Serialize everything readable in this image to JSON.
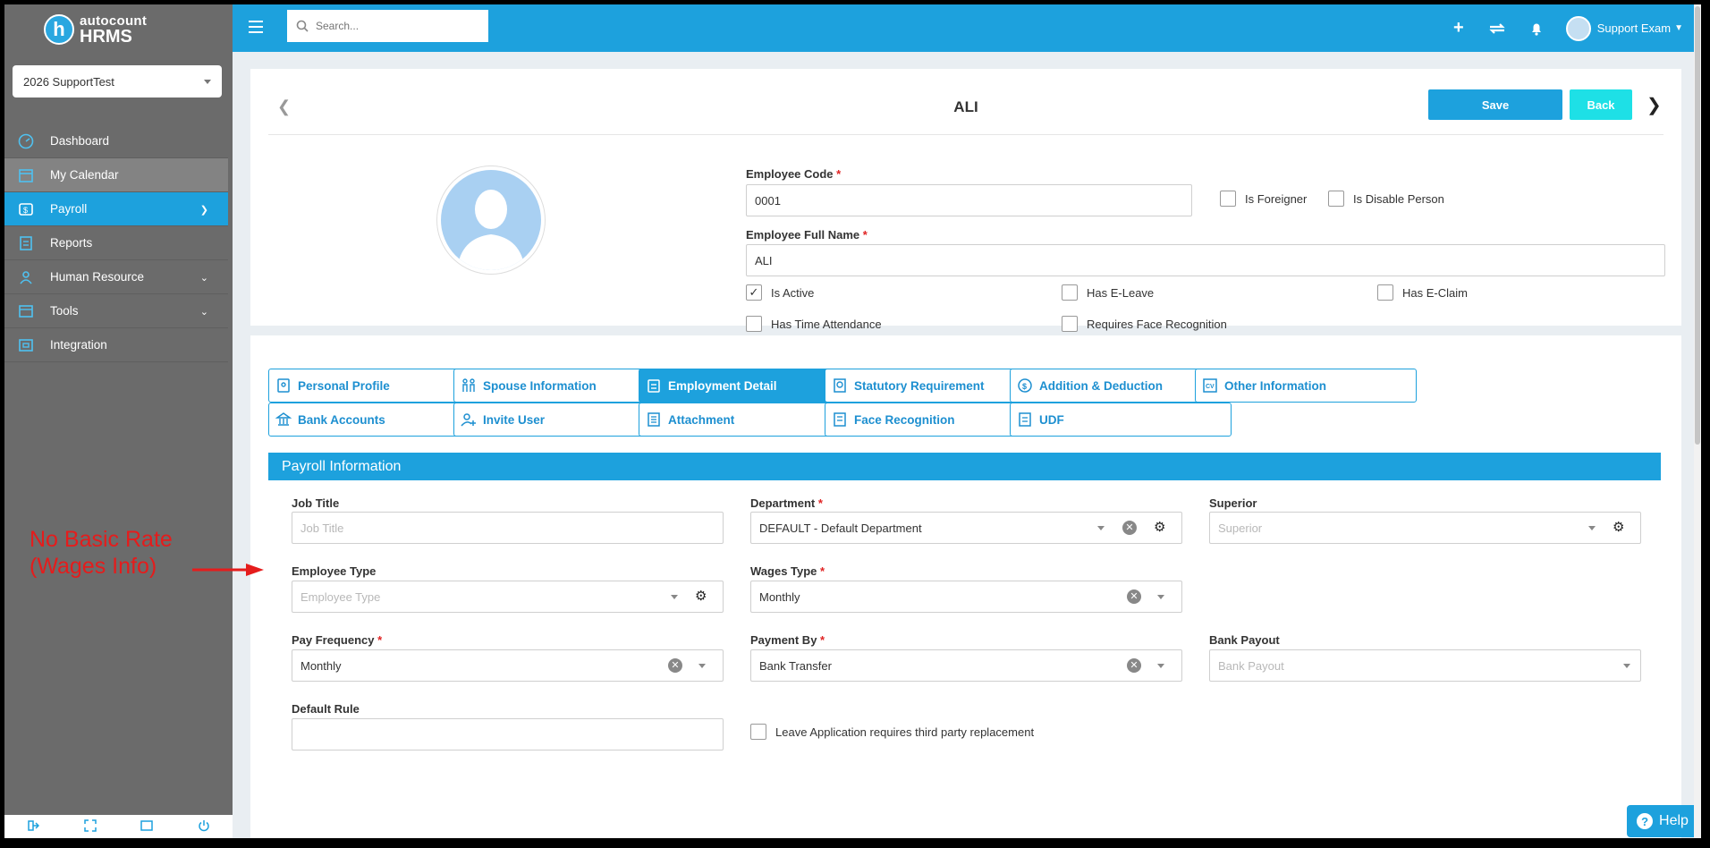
{
  "app": {
    "logo_top": "autocount",
    "logo_bottom": "HRMS",
    "company": "2026 SupportTest"
  },
  "sidebar": {
    "items": [
      {
        "label": "Dashboard",
        "icon": "dashboard-icon"
      },
      {
        "label": "My Calendar",
        "icon": "calendar-icon"
      },
      {
        "label": "Payroll",
        "icon": "payroll-icon"
      },
      {
        "label": "Reports",
        "icon": "reports-icon"
      },
      {
        "label": "Human Resource",
        "icon": "human-resource-icon"
      },
      {
        "label": "Tools",
        "icon": "tools-icon"
      },
      {
        "label": "Integration",
        "icon": "integration-icon"
      }
    ]
  },
  "topbar": {
    "search_placeholder": "Search...",
    "user_name": "Support Exam"
  },
  "header": {
    "employee_name": "ALI",
    "save_label": "Save",
    "back_label": "Back"
  },
  "employee": {
    "code_label": "Employee Code",
    "code_value": "0001",
    "fullname_label": "Employee Full Name",
    "fullname_value": "ALI",
    "is_foreigner_label": "Is Foreigner",
    "is_disable_label": "Is Disable Person",
    "is_active_label": "Is Active",
    "has_eleave_label": "Has E-Leave",
    "has_eclaim_label": "Has E-Claim",
    "has_time_label": "Has Time Attendance",
    "face_req_label": "Requires Face Recognition"
  },
  "tabs": [
    {
      "label": "Personal Profile",
      "icon": "profile-icon"
    },
    {
      "label": "Spouse Information",
      "icon": "spouse-icon"
    },
    {
      "label": "Employment Detail",
      "icon": "employment-icon"
    },
    {
      "label": "Statutory Requirement",
      "icon": "statutory-icon"
    },
    {
      "label": "Addition & Deduction",
      "icon": "addition-icon"
    },
    {
      "label": "Other Information",
      "icon": "other-info-icon"
    },
    {
      "label": "Bank Accounts",
      "icon": "bank-icon"
    },
    {
      "label": "Invite User",
      "icon": "invite-user-icon"
    },
    {
      "label": "Attachment",
      "icon": "attachment-icon"
    },
    {
      "label": "Face Recognition",
      "icon": "face-recognition-icon"
    },
    {
      "label": "UDF",
      "icon": "udf-icon"
    }
  ],
  "payroll": {
    "section_title": "Payroll Information",
    "job_title_label": "Job Title",
    "job_title_placeholder": "Job Title",
    "department_label": "Department",
    "department_value": "DEFAULT - Default Department",
    "superior_label": "Superior",
    "superior_placeholder": "Superior",
    "employee_type_label": "Employee Type",
    "employee_type_placeholder": "Employee Type",
    "wages_type_label": "Wages Type",
    "wages_type_value": "Monthly",
    "pay_frequency_label": "Pay Frequency",
    "pay_frequency_value": "Monthly",
    "payment_by_label": "Payment By",
    "payment_by_value": "Bank Transfer",
    "bank_payout_label": "Bank Payout",
    "bank_payout_placeholder": "Bank Payout",
    "default_rule_label": "Default Rule",
    "leave_replacement_label": "Leave Application requires third party replacement"
  },
  "annotation": {
    "line1": "No Basic Rate",
    "line2": "(Wages Info)"
  },
  "help_label": "Help"
}
